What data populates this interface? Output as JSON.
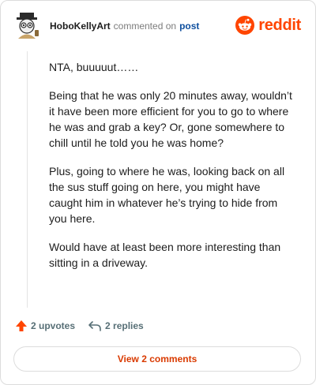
{
  "header": {
    "username": "HoboKellyArt",
    "verb": "commented on",
    "target": "post",
    "brand": "reddit"
  },
  "comment": {
    "paragraphs": [
      "NTA, buuuuut……",
      "Being that he was only 20 minutes away, wouldn’t it have been more efficient for you to go to where he was and grab a key? Or, gone somewhere to chill until he told you he was home?",
      "Plus, going to where he was, looking back on all the sus stuff going on here, you might have caught him in whatever he’s trying to hide from you here.",
      "Would have at least been more interesting than sitting in a driveway."
    ]
  },
  "actions": {
    "upvotes": "2 upvotes",
    "replies": "2 replies"
  },
  "footer": {
    "view_comments": "View 2 comments"
  },
  "colors": {
    "brand": "#ff4500",
    "link": "#0e4f9e",
    "button_text": "#d93a00"
  },
  "icons": [
    "avatar",
    "reddit-logo-icon",
    "upvote-arrow-icon",
    "reply-arrow-icon"
  ]
}
